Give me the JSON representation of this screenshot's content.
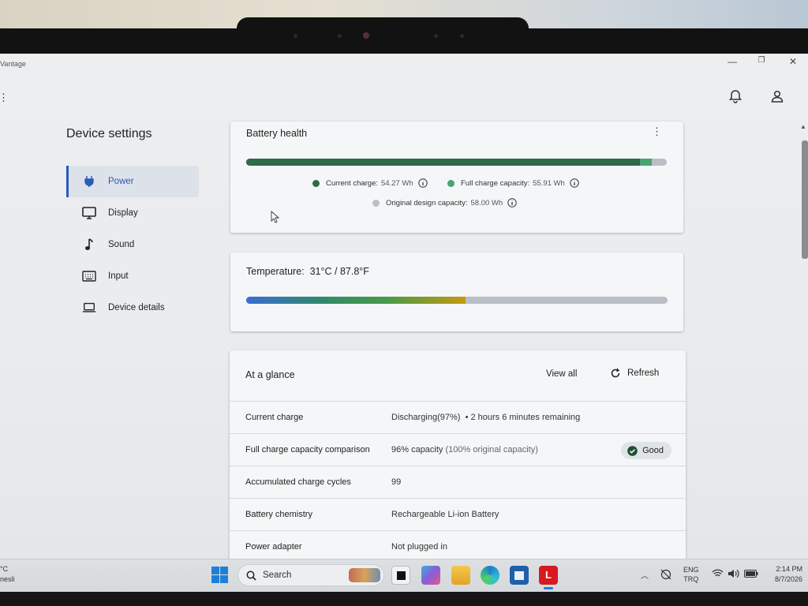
{
  "window": {
    "app_title": "Vantage",
    "minimize": "—",
    "restore": "❐",
    "close": "✕"
  },
  "sidebar": {
    "title": "Device settings",
    "items": [
      {
        "label": "Power",
        "icon": "plug-icon",
        "active": true
      },
      {
        "label": "Display",
        "icon": "monitor-icon"
      },
      {
        "label": "Sound",
        "icon": "music-note-icon"
      },
      {
        "label": "Input",
        "icon": "keyboard-icon"
      },
      {
        "label": "Device details",
        "icon": "laptop-icon"
      }
    ]
  },
  "battery_health": {
    "title": "Battery health",
    "current_charge_label": "Current charge:",
    "current_charge_value": "54.27 Wh",
    "full_capacity_label": "Full charge capacity:",
    "full_capacity_value": "55.91 Wh",
    "design_capacity_label": "Original design capacity:",
    "design_capacity_value": "58.00 Wh",
    "current_charge_wh": 54.27,
    "full_capacity_wh": 55.91,
    "design_capacity_wh": 58.0,
    "colors": {
      "current": "#2e6b4a",
      "full": "#49a373",
      "design": "#b9bfc4"
    }
  },
  "temperature": {
    "label": "Temperature:",
    "value": "31°C / 87.8°F",
    "level_fraction": 0.52
  },
  "glance": {
    "title": "At a glance",
    "view_all": "View all",
    "refresh": "Refresh",
    "rows": [
      {
        "label": "Current charge",
        "value": "Discharging(97%)",
        "extra": "•  2 hours 6 minutes remaining"
      },
      {
        "label": "Full charge capacity comparison",
        "value": "96% capacity",
        "extra": "(100% original capacity)",
        "badge": "Good"
      },
      {
        "label": "Accumulated charge cycles",
        "value": "99"
      },
      {
        "label": "Battery chemistry",
        "value": "Rechargeable Li-ion Battery"
      },
      {
        "label": "Power adapter",
        "value": "Not plugged in"
      }
    ]
  },
  "taskbar": {
    "weather_temp": "°C",
    "weather_text": "nesli",
    "search_label": "Search",
    "lang_top": "ENG",
    "lang_bottom": "TRQ",
    "time": "2:14 PM",
    "date": "8/7/2026"
  }
}
